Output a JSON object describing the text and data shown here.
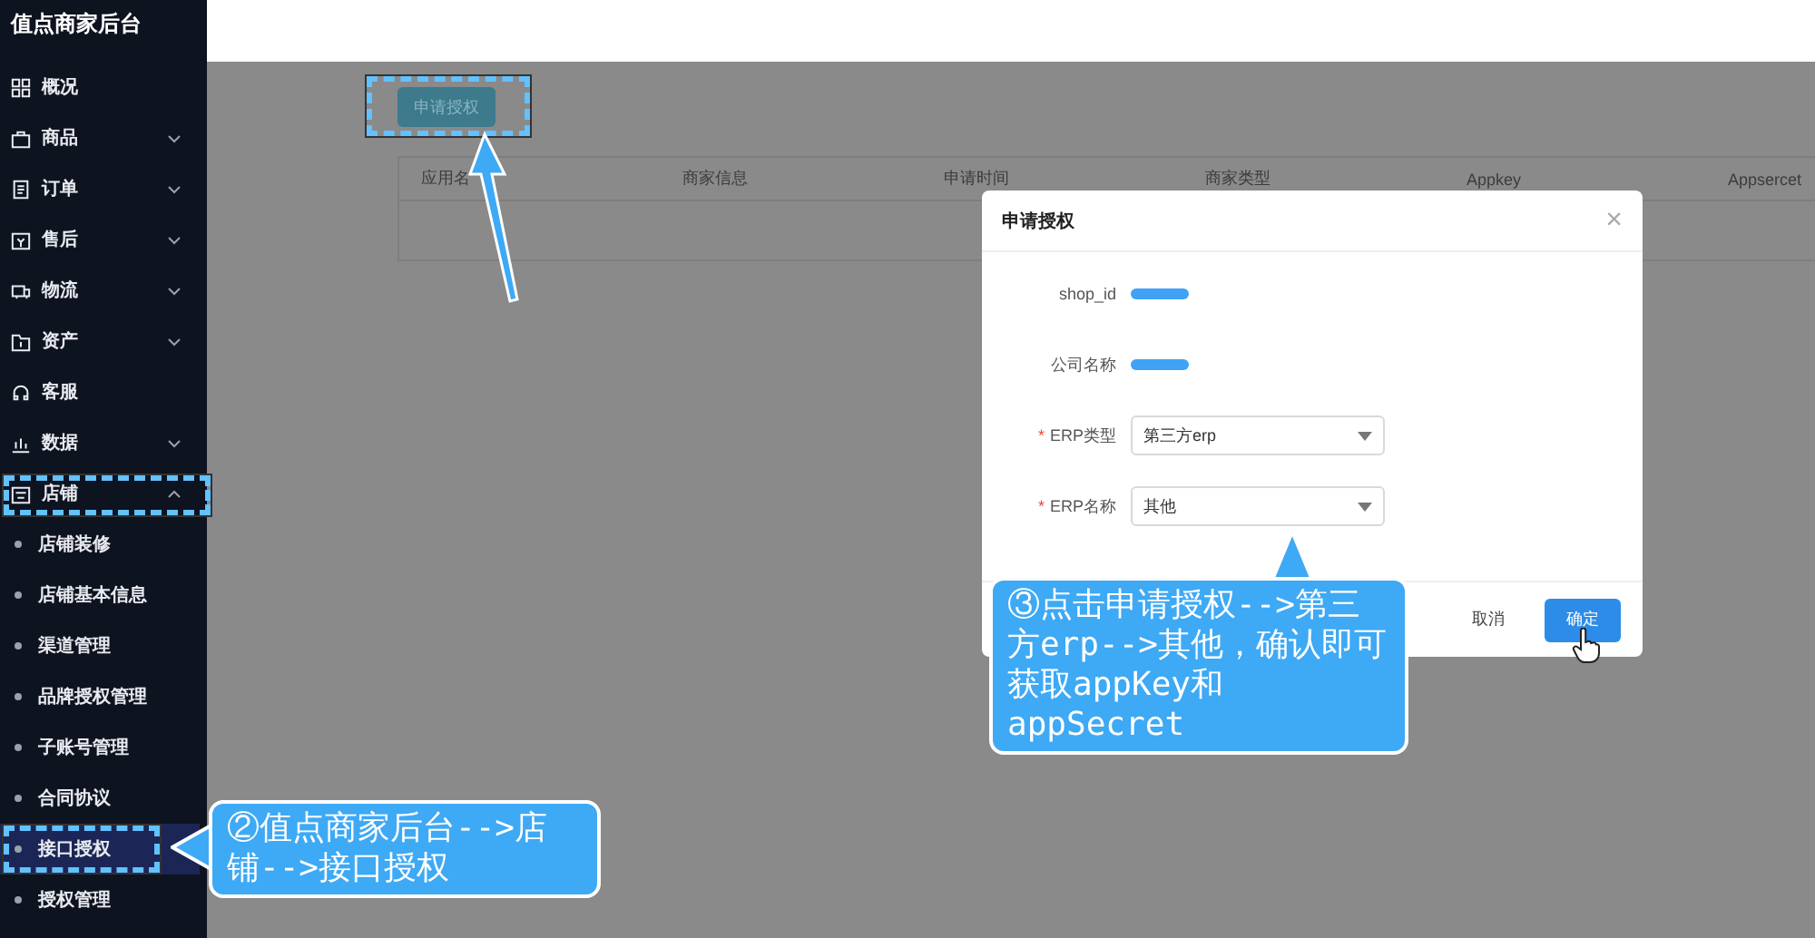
{
  "sidebar": {
    "title": "值点商家后台",
    "items": [
      {
        "label": "概况"
      },
      {
        "label": "商品",
        "expanded": false
      },
      {
        "label": "订单",
        "expanded": false
      },
      {
        "label": "售后",
        "expanded": false
      },
      {
        "label": "物流",
        "expanded": false
      },
      {
        "label": "资产",
        "expanded": false
      },
      {
        "label": "客服"
      },
      {
        "label": "数据",
        "expanded": false
      },
      {
        "label": "店铺",
        "expanded": true,
        "children": [
          {
            "label": "店铺装修",
            "selected": false
          },
          {
            "label": "店铺基本信息",
            "selected": false
          },
          {
            "label": "渠道管理",
            "selected": false
          },
          {
            "label": "品牌授权管理",
            "selected": false
          },
          {
            "label": "子账号管理",
            "selected": false
          },
          {
            "label": "合同协议",
            "selected": false
          },
          {
            "label": "接口授权",
            "selected": true
          },
          {
            "label": "授权管理",
            "selected": false
          }
        ]
      }
    ]
  },
  "toolbar": {
    "apply_button": "申请授权"
  },
  "table": {
    "columns": [
      "应用名",
      "商家信息",
      "申请时间",
      "商家类型",
      "Appkey",
      "Appsercet"
    ]
  },
  "dialog": {
    "title": "申请授权",
    "close": "×",
    "required_mark": "*",
    "fields": [
      {
        "kind": "redacted",
        "label": "shop_id",
        "required": false
      },
      {
        "kind": "redacted",
        "label": "公司名称",
        "required": false
      },
      {
        "kind": "select",
        "label": "ERP类型",
        "required": true,
        "value": "第三方erp"
      },
      {
        "kind": "select",
        "label": "ERP名称",
        "required": true,
        "value": "其他"
      }
    ],
    "buttons": [
      {
        "label": "取消",
        "primary": false
      },
      {
        "label": "确定",
        "primary": true
      }
    ]
  },
  "annotations": [
    {
      "text": "②值点商家后台-->店铺-->接口授权"
    },
    {
      "text": "③点击申请授权-->第三方erp-->其他，确认即可获取appKey和appSecret"
    }
  ]
}
